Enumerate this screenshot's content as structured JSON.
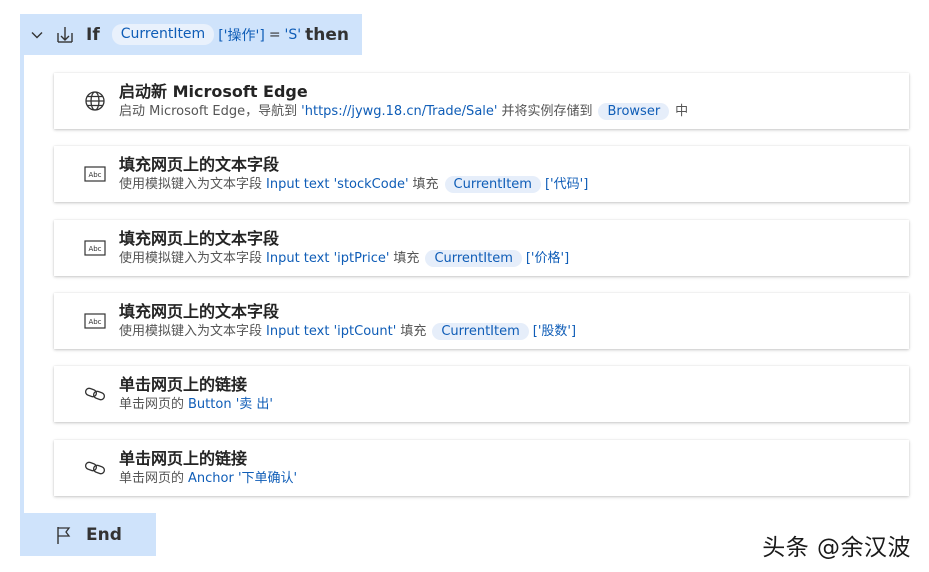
{
  "if_block": {
    "keyword": "If",
    "variable": "CurrentItem",
    "index": "['操作']",
    "operator": "=",
    "value": "'S'",
    "then": "then"
  },
  "actions": [
    {
      "icon": "globe-icon",
      "title": "启动新 Microsoft Edge",
      "desc_prefix": "启动 Microsoft Edge，导航到",
      "desc_link": "'https://jywg.18.cn/Trade/Sale'",
      "desc_middle": "并将实例存储到",
      "desc_var": "Browser",
      "desc_suffix": "中"
    },
    {
      "icon": "textbox-icon",
      "title": "填充网页上的文本字段",
      "desc_prefix": "使用模拟键入为文本字段",
      "desc_link": "Input text 'stockCode'",
      "desc_middle": "填充",
      "desc_var": "CurrentItem",
      "desc_index": "['代码']"
    },
    {
      "icon": "textbox-icon",
      "title": "填充网页上的文本字段",
      "desc_prefix": "使用模拟键入为文本字段",
      "desc_link": "Input text 'iptPrice'",
      "desc_middle": "填充",
      "desc_var": "CurrentItem",
      "desc_index": "['价格']"
    },
    {
      "icon": "textbox-icon",
      "title": "填充网页上的文本字段",
      "desc_prefix": "使用模拟键入为文本字段",
      "desc_link": "Input text 'iptCount'",
      "desc_middle": "填充",
      "desc_var": "CurrentItem",
      "desc_index": "['股数']"
    },
    {
      "icon": "link-icon",
      "title": "单击网页上的链接",
      "desc_prefix": "单击网页的",
      "desc_link": "Button '卖 出'"
    },
    {
      "icon": "link-icon",
      "title": "单击网页上的链接",
      "desc_prefix": "单击网页的",
      "desc_link": "Anchor '下单确认'"
    }
  ],
  "end_block": {
    "label": "End"
  },
  "watermark": "头条 @余汉波",
  "colors": {
    "block_bg": "#cfe3fb",
    "pill_bg": "#e6eefa",
    "link": "#0f5db7"
  }
}
